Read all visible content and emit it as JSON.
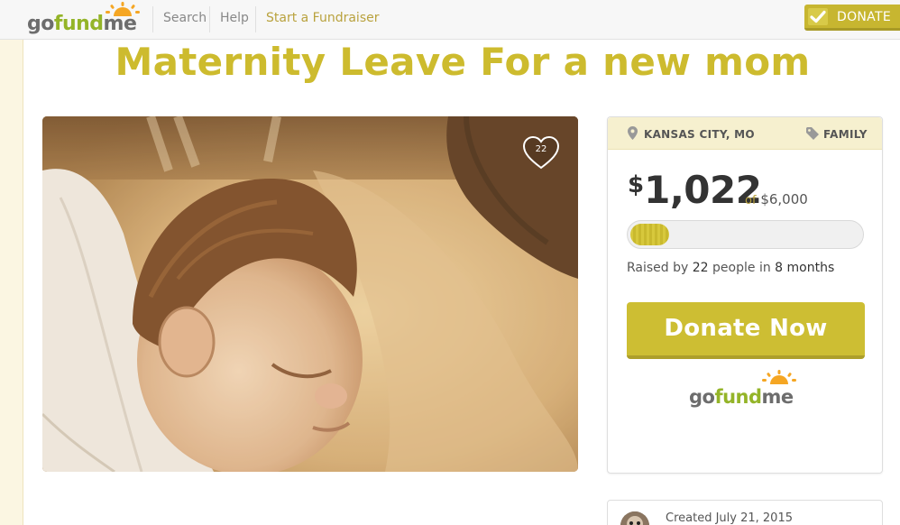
{
  "nav": {
    "logo": {
      "go": "go",
      "fund": "fund",
      "me": "me"
    },
    "search_label": "Search",
    "help_label": "Help",
    "start_label": "Start a Fundraiser",
    "donate_label": "DONATE"
  },
  "campaign": {
    "title": "Maternity Leave For a new mom",
    "heart_count": "22",
    "location": "KANSAS CITY, MO",
    "category": "FAMILY",
    "currency": "$",
    "raised_amount": "1,022",
    "goal_prefix": "of",
    "goal_amount": "$6,000",
    "progress_fraction": 0.17,
    "raised_by_prefix": "Raised by",
    "donor_count": "22",
    "raised_by_mid": "people in",
    "duration": "8 months",
    "donate_button": "Donate Now",
    "created_text": "Created July 21, 2015"
  },
  "colors": {
    "brand_gold": "#cdbb2e",
    "brand_green": "#94b428",
    "sun_orange": "#f5a623"
  }
}
